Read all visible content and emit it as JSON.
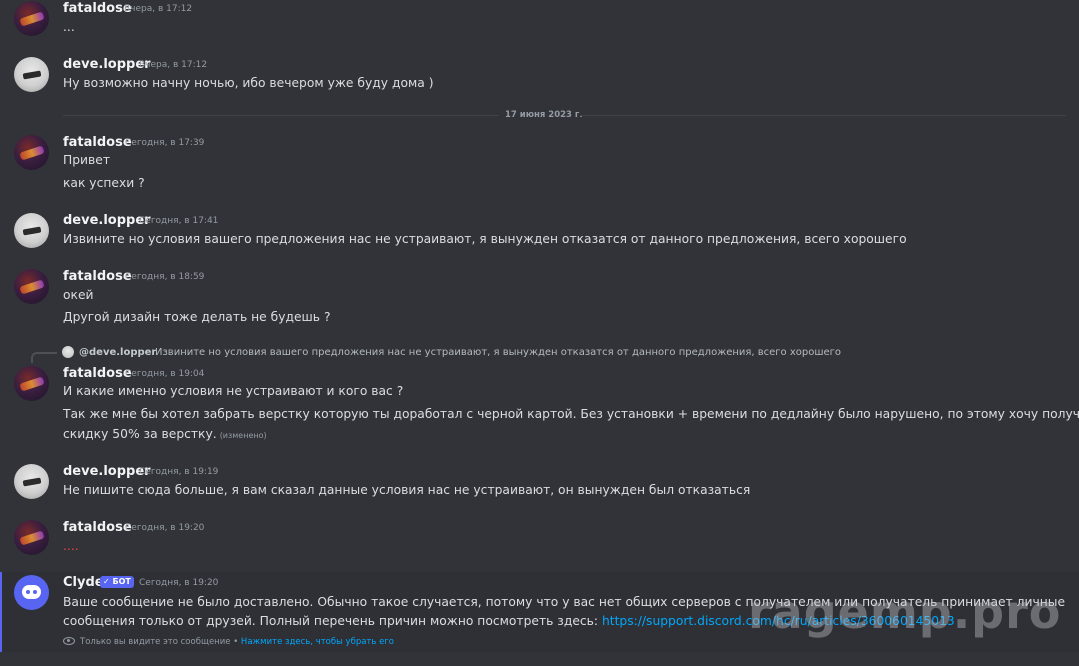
{
  "messages": {
    "m1": {
      "author": "fataldose",
      "timestamp": "Вчера, в 17:12",
      "lines": [
        "..."
      ]
    },
    "m2": {
      "author": "deve.lopper",
      "timestamp": "Вчера, в 17:12",
      "lines": [
        "Ну возможно начну ночью, ибо вечером уже буду дома )"
      ]
    },
    "divider": "17 июня 2023 г.",
    "m3": {
      "author": "fataldose",
      "timestamp": "Сегодня, в 17:39",
      "lines": [
        "Привет",
        "как успехи ?"
      ]
    },
    "m4": {
      "author": "deve.lopper",
      "timestamp": "Сегодня, в 17:41",
      "lines": [
        "Извините но условия вашего предложения нас не устраивают, я вынужден отказатся от данного предложения, всего хорошего"
      ]
    },
    "m5": {
      "author": "fataldose",
      "timestamp": "Сегодня, в 18:59",
      "lines": [
        "окей",
        "Другой дизайн тоже делать не будешь ?"
      ]
    },
    "m6": {
      "reply_to": "@deve.lopper",
      "reply_text": "Извините но условия вашего предложения нас не устраивают, я вынужден отказатся от данного предложения, всего хорошего",
      "author": "fataldose",
      "timestamp": "Сегодня, в 19:04",
      "lines": [
        "И какие именно условия не устраивают и кого вас ?",
        "Так же мне бы хотел забрать верстку которую ты доработал с черной картой. Без установки + времени по дедлайну было нарушено, по этому хочу получить",
        "скидку 50% за верстку."
      ],
      "edited": "(изменено)"
    },
    "m7": {
      "author": "deve.lopper",
      "timestamp": "Сегодня, в 19:19",
      "lines": [
        "Не пишите сюда больше, я вам сказал данные условия нас не устраивают, он вынужден был отказаться"
      ]
    },
    "m8": {
      "author": "fataldose",
      "timestamp": "Сегодня, в 19:20",
      "lines": [
        "...."
      ]
    },
    "m9": {
      "author": "Clyde",
      "badge": "✓ БОТ",
      "timestamp": "Сегодня, в 19:20",
      "lines": [
        "Ваше сообщение не было доставлено. Обычно такое случается, потому что у вас нет общих серверов с получателем или получатель принимает личные",
        "сообщения только от друзей. Полный перечень причин можно посмотреть здесь: "
      ],
      "link": "https://support.discord.com/hc/ru/articles/360060145013",
      "ephemeral_note": "Только вы видите это сообщение • ",
      "dismiss_link": "Нажмите здесь, чтобы убрать его"
    }
  },
  "watermark": "ragemp.pro",
  "colors": {
    "background": "#313338",
    "accent": "#5865f2",
    "link": "#00a8fc",
    "danger": "#f23f43"
  }
}
